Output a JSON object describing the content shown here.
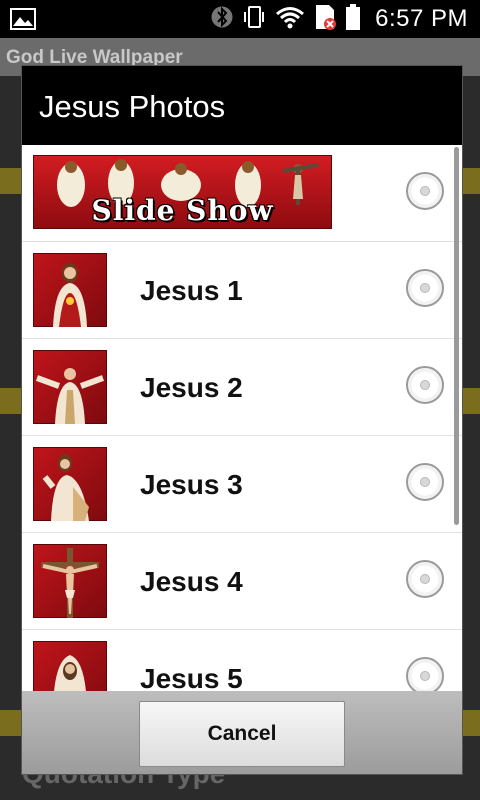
{
  "status_bar": {
    "time": "6:57 PM",
    "icons": [
      "gallery-icon",
      "bluetooth-icon",
      "vibrate-icon",
      "wifi-icon",
      "sim-error-icon",
      "battery-icon"
    ]
  },
  "background_app": {
    "title": "God Live Wallpaper",
    "section_label": "Quotation Type"
  },
  "dialog": {
    "title": "Jesus Photos",
    "items": [
      {
        "label": "Slide Show",
        "type": "banner",
        "selected": false
      },
      {
        "label": "Jesus 1",
        "selected": false
      },
      {
        "label": "Jesus 2",
        "selected": false
      },
      {
        "label": "Jesus 3",
        "selected": false
      },
      {
        "label": "Jesus 4",
        "selected": false
      },
      {
        "label": "Jesus 5",
        "selected": false
      }
    ],
    "cancel_label": "Cancel"
  },
  "colors": {
    "title_bg": "#000000",
    "thumb_red": "#c0151b",
    "footer_gray": "#a8a8a8"
  }
}
